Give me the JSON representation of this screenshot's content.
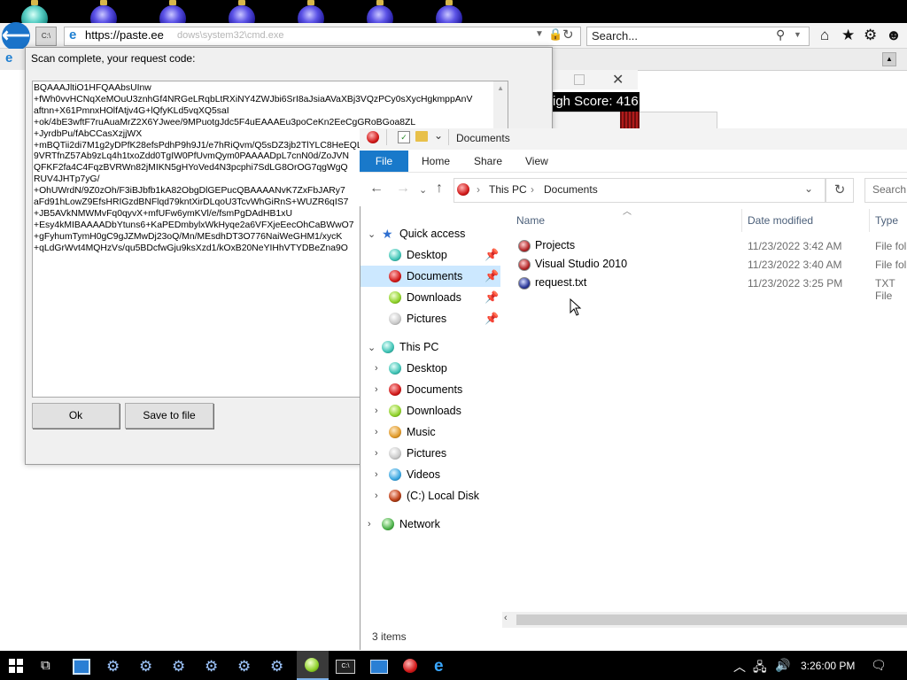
{
  "browser": {
    "address_url": "https://paste.ee",
    "address_ghost": "dows\\system32\\cmd.exe",
    "search_placeholder": "Search...",
    "back_icon": "back-arrow-icon"
  },
  "game": {
    "score_label": "igh Score: 416"
  },
  "dialog": {
    "message": "Scan complete, your request code:",
    "code_text": "BQAAAJltiO1HFQAAbsUInw\n+fWh0vvHCNqXeMOuU3znhGf4NRGeLRqbLtRXiNY4ZWJbi6SrI8aJsiaAVaXBj3VQzPCy0sXycHgkmppAnV\naftnn+X61PmnxHOlfAtjv4G+lQfyKLd5vqXQ5saI\n+ok/4bE3wftF7ruAuaMrZ2X6YJwee/9MPuotgJdc5F4uEAAAEu3poCeKn2EeCgGRoBGoa8ZL\n+JyrdbPu/fAbCCasXzjjWX\n+mBQTii2di7M1g2yDPfK28efsPdhP9h9J1/e7hRiQvm/Q5sDZ3jb2TlYLC8HeEQLRNFs9GF3dTRFFBNDVh6\n9VRTfnZ57Ab9zLq4h1txoZdd0TgIW0PfUvmQym0PAAAADpL7cnN0d/ZoJVN\nQFKF2fa4C4FqzBVRWn82jMIKN5gHYoVed4N3pcphi7SdLG8OrOG7qgWgQ\nRUV4JHTp7yG/\n+OhUWrdN/9Z0zOh/F3iBJbfb1kA82ObgDlGEPucQBAAAANvK7ZxFbJARy7\naFd91hLowZ9EfsHRIGzdBNFlqd79kntXirDLqoU3TcvWhGiRnS+WUZR6qIS7\n+JB5AVkNMWMvFq0qyvX+mfUFw6ymKVl/e/fsmPgDAdHB1xU\n+Esy4kMIBAAAADbYtuns6+KaPEDmbylxWkHyqe2a6VFXjeEecOhCaBWwO7\n+gFyhumTymH0gC9gJZMwDj23oQ/Mn/MEsdhDT3O776NaiWeGHM1/xycK\n+qLdGrWvt4MQHzVs/qu5BDcfwGju9ksXzd1/kOxB20NeYIHhVTYDBeZna9O",
    "ok_label": "Ok",
    "save_label": "Save to file"
  },
  "explorer": {
    "title": "Documents",
    "ribbon_tabs": [
      "File",
      "Home",
      "Share",
      "View"
    ],
    "breadcrumb": [
      "This PC",
      "Documents"
    ],
    "search_placeholder": "Search",
    "quick_access_label": "Quick access",
    "quick_access": [
      "Desktop",
      "Documents",
      "Downloads",
      "Pictures"
    ],
    "this_pc_label": "This PC",
    "this_pc": [
      "Desktop",
      "Documents",
      "Downloads",
      "Music",
      "Pictures",
      "Videos",
      "(C:) Local Disk"
    ],
    "network_label": "Network",
    "columns": {
      "name": "Name",
      "date": "Date modified",
      "type": "Type"
    },
    "files": [
      {
        "name": "Projects",
        "date": "11/23/2022 3:42 AM",
        "type": "File fol"
      },
      {
        "name": "Visual Studio 2010",
        "date": "11/23/2022 3:40 AM",
        "type": "File fol"
      },
      {
        "name": "request.txt",
        "date": "11/23/2022 3:25 PM",
        "type": "TXT File"
      }
    ],
    "status": "3 items"
  },
  "taskbar": {
    "clock": "3:26:00 PM"
  },
  "colors": {
    "accent": "#1979ca",
    "selection": "#cce8ff",
    "taskbar": "#000000"
  }
}
